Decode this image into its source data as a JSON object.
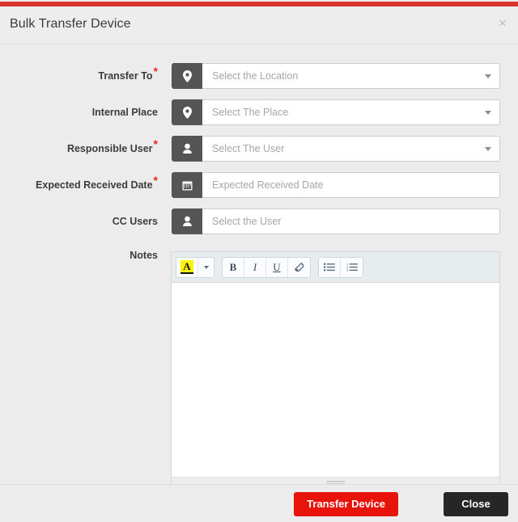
{
  "window": {
    "accent_color": "#d9342b",
    "background": "#ececec"
  },
  "header": {
    "title": "Bulk Transfer Device",
    "close_label": "×"
  },
  "form": {
    "rows": [
      {
        "label": "Transfer To",
        "required": true,
        "icon": "map-pin-icon",
        "placeholder": "Select the Location",
        "value": "",
        "has_caret": true,
        "name": "transfer-to"
      },
      {
        "label": "Internal Place",
        "required": false,
        "icon": "map-pin-icon",
        "placeholder": "Select The Place",
        "value": "",
        "has_caret": true,
        "name": "internal-place"
      },
      {
        "label": "Responsible User",
        "required": true,
        "icon": "user-icon",
        "placeholder": "Select The User",
        "value": "",
        "has_caret": true,
        "name": "responsible-user"
      },
      {
        "label": "Expected Received Date",
        "required": true,
        "icon": "calendar-icon",
        "placeholder": "Expected Received Date",
        "value": "",
        "has_caret": false,
        "name": "expected-received-date"
      },
      {
        "label": "CC Users",
        "required": false,
        "icon": "user-icon",
        "placeholder": "Select the User",
        "value": "",
        "has_caret": false,
        "name": "cc-users"
      }
    ],
    "notes": {
      "label": "Notes",
      "content": "",
      "toolbar": {
        "highlight_label": "A",
        "highlight_color": "#fbf305",
        "dropdown_label": "",
        "bold_label": "B",
        "italic_label": "I",
        "underline_label": "U",
        "remove_format_label": "",
        "unordered_list_label": "",
        "ordered_list_label": ""
      }
    }
  },
  "footer": {
    "submit_label": "Transfer Device",
    "submit_color": "#e8140c",
    "cancel_label": "Close",
    "cancel_color": "#262626"
  }
}
